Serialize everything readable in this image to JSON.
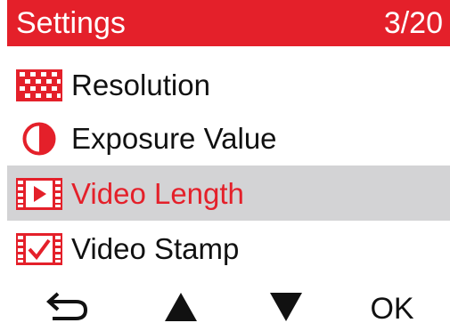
{
  "header": {
    "title": "Settings",
    "page_indicator": "3/20"
  },
  "menu": {
    "items": [
      {
        "label": "Resolution",
        "icon": "resolution-icon",
        "selected": false
      },
      {
        "label": "Exposure Value",
        "icon": "exposure-icon",
        "selected": false
      },
      {
        "label": "Video Length",
        "icon": "video-length-icon",
        "selected": true
      },
      {
        "label": "Video Stamp",
        "icon": "video-stamp-icon",
        "selected": false
      }
    ]
  },
  "nav": {
    "back_icon": "back-arrow-icon",
    "up_icon": "triangle-up-icon",
    "down_icon": "triangle-down-icon",
    "ok_label": "OK"
  },
  "colors": {
    "accent": "#e4202a",
    "selected_bg": "#d3d3d5",
    "text": "#111111"
  }
}
